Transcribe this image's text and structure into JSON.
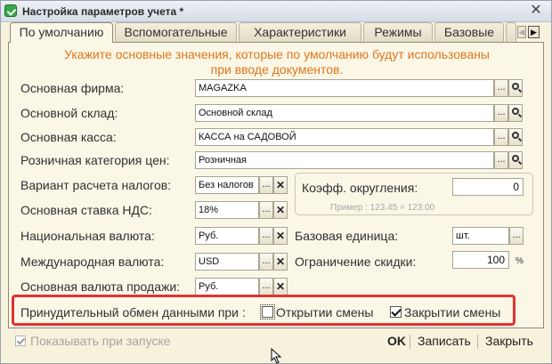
{
  "window": {
    "title": "Настройка параметров учета *",
    "close_glyph": "✕"
  },
  "tabs": [
    {
      "label": "По умолчанию",
      "active": true
    },
    {
      "label": "Вспомогательные",
      "active": false
    },
    {
      "label": "Характеристики",
      "active": false
    },
    {
      "label": "Режимы",
      "active": false
    },
    {
      "label": "Базовые",
      "active": false
    }
  ],
  "tab_nav": {
    "left": "◀",
    "right": "▶"
  },
  "hint": {
    "line1": "Укажите основные значения, которые по умолчанию будут использованы",
    "line2": "при вводе документов."
  },
  "fields": {
    "firm": {
      "label": "Основная фирма:",
      "value": "MAGAZKA"
    },
    "warehouse": {
      "label": "Основной склад:",
      "value": "Основной склад"
    },
    "cash": {
      "label": "Основная касса:",
      "value": "КАССА на САДОВОЙ"
    },
    "price_category": {
      "label": "Розничная категория цен:",
      "value": "Розничная"
    },
    "tax_variant": {
      "label": "Вариант расчета налогов:",
      "value": "Без налогов"
    },
    "vat_rate": {
      "label": "Основная ставка НДС:",
      "value": "18%"
    },
    "national_currency": {
      "label": "Национальная валюта:",
      "value": "Руб."
    },
    "international_currency": {
      "label": "Международная валюта:",
      "value": "USD"
    },
    "sales_currency": {
      "label": "Основная валюта продажи:",
      "value": "Руб."
    },
    "rounding_coef": {
      "label": "Коэфф. округления:",
      "value": "0",
      "example": "Пример : 123.45 = 123.00"
    },
    "base_unit": {
      "label": "Базовая единица:",
      "value": "шт."
    },
    "discount_limit": {
      "label": "Ограничение скидки:",
      "value": "100",
      "unit": "%"
    }
  },
  "buttons": {
    "select_glyph": "...",
    "clear_glyph": "✕"
  },
  "exchange": {
    "label": "Принудительный обмен данными  при :",
    "open_shift": {
      "label": "Открытии смены",
      "checked": false
    },
    "close_shift": {
      "label": "Закрытии смены",
      "checked": true
    }
  },
  "footer": {
    "show_on_start": {
      "label": "Показывать при запуске",
      "checked": true
    },
    "ok": "OK",
    "save": "Записать",
    "close": "Закрыть"
  },
  "colors": {
    "hint": "#e0761b",
    "highlight_box": "#e23232",
    "panel_bg": "#fbf7e7"
  }
}
